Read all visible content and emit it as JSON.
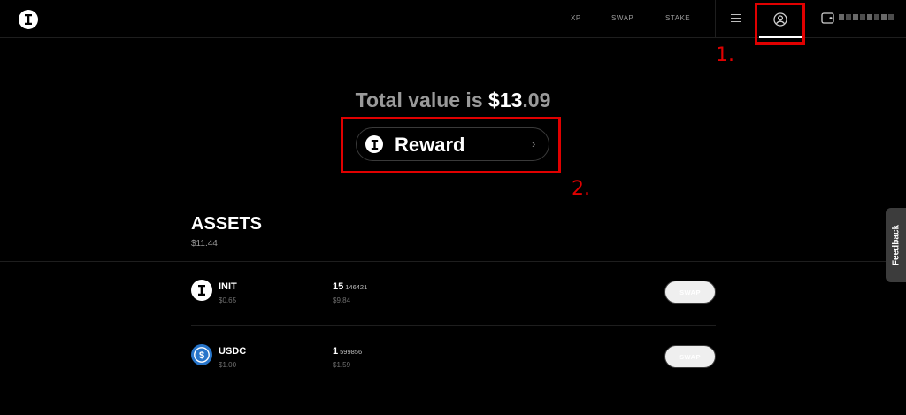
{
  "nav": {
    "logo": "initia-logo-icon",
    "links": [
      {
        "label": "XP"
      },
      {
        "label": "SWAP"
      },
      {
        "label": "STAKE"
      }
    ],
    "menu_icon": "hamburger-icon",
    "profile_icon": "user-circle-icon",
    "wallet_icon": "wallet-icon"
  },
  "annotations": {
    "step1": "1.",
    "step2": "2.",
    "color": "#e00000"
  },
  "summary": {
    "prefix": "Total value is ",
    "amount_int": "$13",
    "amount_dec": ".09"
  },
  "reward": {
    "label": "Reward",
    "chevron": "›"
  },
  "assets": {
    "title": "ASSETS",
    "total": "$11.44",
    "rows": [
      {
        "symbol": "INIT",
        "price": "$0.65",
        "amount_int": "15",
        "amount_dec": "146421",
        "value": "$9.84",
        "action": "SWAP",
        "icon": "init-token-icon"
      },
      {
        "symbol": "USDC",
        "price": "$1.00",
        "amount_int": "1",
        "amount_dec": "599856",
        "value": "$1.59",
        "action": "SWAP",
        "icon": "usdc-token-icon"
      }
    ]
  },
  "feedback": {
    "label": "Feedback"
  }
}
